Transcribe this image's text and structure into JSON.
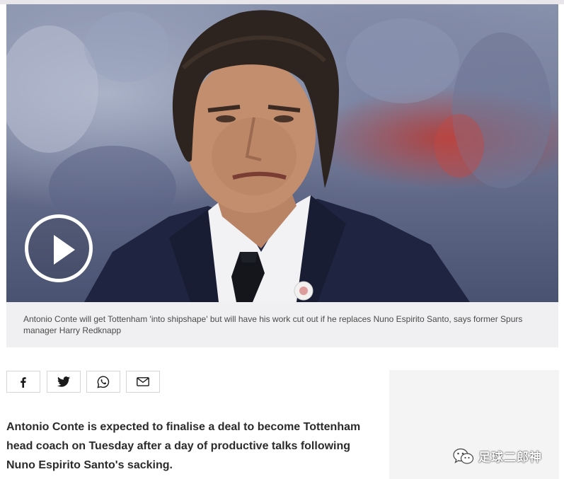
{
  "video": {
    "play_label": "Play video",
    "caption": "Antonio Conte will get Tottenham 'into shipshape' but will have his work cut out if he replaces Nuno Espirito Santo, says former Spurs manager Harry Redknapp"
  },
  "share": {
    "items": [
      {
        "label": "Facebook",
        "icon": "facebook-icon"
      },
      {
        "label": "Twitter",
        "icon": "twitter-icon"
      },
      {
        "label": "WhatsApp",
        "icon": "whatsapp-icon"
      },
      {
        "label": "Email",
        "icon": "email-icon"
      }
    ]
  },
  "article": {
    "lead": "Antonio Conte is expected to finalise a deal to become Tottenham head coach on Tuesday after a day of productive talks following Nuno Espirito Santo's sacking."
  },
  "watermark": {
    "text": "足球二郎神",
    "icon": "wechat-icon"
  },
  "colors": {
    "caption_bg": "#f0f0f2",
    "suit": "#1f2540",
    "text": "#2b2b2b"
  }
}
